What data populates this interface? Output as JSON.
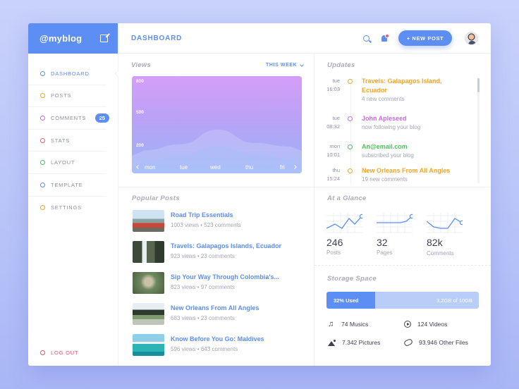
{
  "brand": {
    "name": "@myblog"
  },
  "header": {
    "title": "DASHBOARD",
    "new_post": "+ NEW POST"
  },
  "nav": {
    "items": [
      {
        "label": "DASHBOARD",
        "color": "#5d8ef3"
      },
      {
        "label": "POSTS",
        "color": "#f5a623"
      },
      {
        "label": "COMMENTS",
        "color": "#c76ddf",
        "badge": "25"
      },
      {
        "label": "STATS",
        "color": "#ee5a7a"
      },
      {
        "label": "LAYOUT",
        "color": "#4cc15c"
      },
      {
        "label": "TEMPLATE",
        "color": "#5d8ef3"
      },
      {
        "label": "SETTINGS",
        "color": "#f5a623"
      }
    ],
    "logout": "LOG OUT"
  },
  "views": {
    "title": "Views",
    "period": "THIS WEEK",
    "yticks": [
      "800",
      "500",
      "200"
    ],
    "xticks": [
      "mon",
      "tue",
      "wed",
      "thu",
      "fri"
    ]
  },
  "chart_data": {
    "type": "area",
    "title": "Views",
    "categories": [
      "mon",
      "tue",
      "wed",
      "thu",
      "fri"
    ],
    "series": [
      {
        "values": [
          270,
          320,
          440,
          330,
          300
        ]
      },
      {
        "values": [
          180,
          230,
          300,
          240,
          200
        ]
      }
    ],
    "ylim": [
      80,
      880
    ],
    "yticks": [
      200,
      500,
      800
    ]
  },
  "updates": {
    "title": "Updates",
    "items": [
      {
        "day": "tue",
        "time": "16:03",
        "title": "Travels: Galapagos Island, Ecuador",
        "sub": "4 new comments",
        "color": "#f5a623"
      },
      {
        "day": "tue",
        "time": "08:32",
        "title": "John Apleseed",
        "sub": "now following your blog",
        "color": "#c76ddf"
      },
      {
        "day": "mon",
        "time": "10:01",
        "title": "An@email.com",
        "sub": "subscribed your blog",
        "color": "#4cc15c"
      },
      {
        "day": "thu",
        "time": "15:24",
        "title": "New Orleans From All Angles",
        "sub": "19 new comments",
        "color": "#f5a623"
      }
    ]
  },
  "popular": {
    "title": "Popular Posts",
    "items": [
      {
        "title": "Road Trip Essentials",
        "views": "1003 views",
        "comments": "523 comments"
      },
      {
        "title": "Travels: Galapagos Islands, Ecuador",
        "views": "923 views",
        "comments": "23 comments"
      },
      {
        "title": "Sip Your Way Through Colombia's...",
        "views": "823 views",
        "comments": "97 comments"
      },
      {
        "title": "New Orleans From All Angles",
        "views": "683 views",
        "comments": "23 comments"
      },
      {
        "title": "Know Before You Go: Maldives",
        "views": "596 views",
        "comments": "643 comments"
      }
    ]
  },
  "glance": {
    "title": "At a Glance",
    "stats": [
      {
        "value": "246",
        "label": "Posts"
      },
      {
        "value": "32",
        "label": "Pages"
      },
      {
        "value": "82k",
        "label": "Comments"
      }
    ]
  },
  "storage": {
    "title": "Storage Space",
    "used_label": "32% Used",
    "used_fraction": 0.32,
    "total_label": "3.2GB of 10GB",
    "items": [
      {
        "label": "74 Musics",
        "icon": "music-note-icon"
      },
      {
        "label": "124 Videos",
        "icon": "play-circle-icon"
      },
      {
        "label": "7.342 Pictures",
        "icon": "image-icon"
      },
      {
        "label": "93.946 Other Files",
        "icon": "paperclip-icon"
      }
    ]
  }
}
